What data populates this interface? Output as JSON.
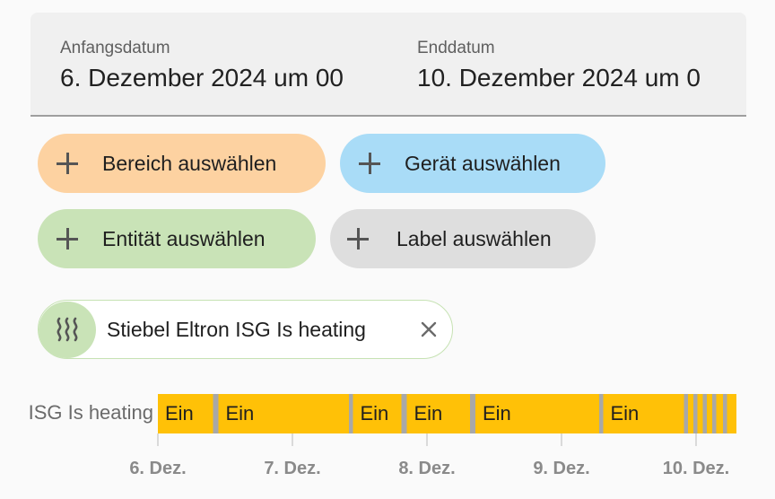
{
  "date_range": {
    "start_label": "Anfangsdatum",
    "start_value": "6. Dezember 2024 um 00",
    "end_label": "Enddatum",
    "end_value": "10. Dezember 2024 um 0"
  },
  "target_chips": {
    "area": "Bereich auswählen",
    "device": "Gerät auswählen",
    "entity": "Entität auswählen",
    "label": "Label auswählen"
  },
  "selected_entity": {
    "name": "Stiebel Eltron ISG Is heating",
    "icon": "heating-icon",
    "remove_icon": "close-icon"
  },
  "colors": {
    "on": "#ffc107",
    "off": "#a8a8a8",
    "area_chip": "#fdd2a1",
    "device_chip": "#a9dcf7",
    "entity_chip": "#c9e3b7",
    "label_chip": "#dedede"
  },
  "chart_data": {
    "type": "timeline",
    "row_label": "ISG Is heating",
    "x_range": [
      "6. Dez.",
      "10. Dez."
    ],
    "x_ticks": [
      "6. Dez.",
      "7. Dez.",
      "8. Dez.",
      "9. Dez.",
      "10. Dez."
    ],
    "states": [
      {
        "state": "Ein",
        "start": 0.0,
        "end": 0.41,
        "label": "Ein"
      },
      {
        "state": "Aus",
        "start": 0.41,
        "end": 0.45
      },
      {
        "state": "Ein",
        "start": 0.45,
        "end": 1.42,
        "label": "Ein"
      },
      {
        "state": "Aus",
        "start": 1.42,
        "end": 1.45
      },
      {
        "state": "Ein",
        "start": 1.45,
        "end": 1.81,
        "label": "Ein"
      },
      {
        "state": "Aus",
        "start": 1.81,
        "end": 1.85
      },
      {
        "state": "Ein",
        "start": 1.85,
        "end": 2.32,
        "label": "Ein"
      },
      {
        "state": "Aus",
        "start": 2.32,
        "end": 2.36
      },
      {
        "state": "Ein",
        "start": 2.36,
        "end": 3.28,
        "label": "Ein"
      },
      {
        "state": "Aus",
        "start": 3.28,
        "end": 3.31
      },
      {
        "state": "Ein",
        "start": 3.31,
        "end": 3.91,
        "label": "Ein"
      },
      {
        "state": "Aus",
        "start": 3.91,
        "end": 3.94
      },
      {
        "state": "Ein",
        "start": 3.94,
        "end": 3.98
      },
      {
        "state": "Aus",
        "start": 3.98,
        "end": 4.01
      },
      {
        "state": "Ein",
        "start": 4.01,
        "end": 4.05
      },
      {
        "state": "Aus",
        "start": 4.05,
        "end": 4.08
      },
      {
        "state": "Ein",
        "start": 4.08,
        "end": 4.12
      },
      {
        "state": "Aus",
        "start": 4.12,
        "end": 4.15
      },
      {
        "state": "Ein",
        "start": 4.15,
        "end": 4.2
      },
      {
        "state": "Aus",
        "start": 4.2,
        "end": 4.23
      },
      {
        "state": "Ein",
        "start": 4.23,
        "end": 4.3
      }
    ]
  }
}
